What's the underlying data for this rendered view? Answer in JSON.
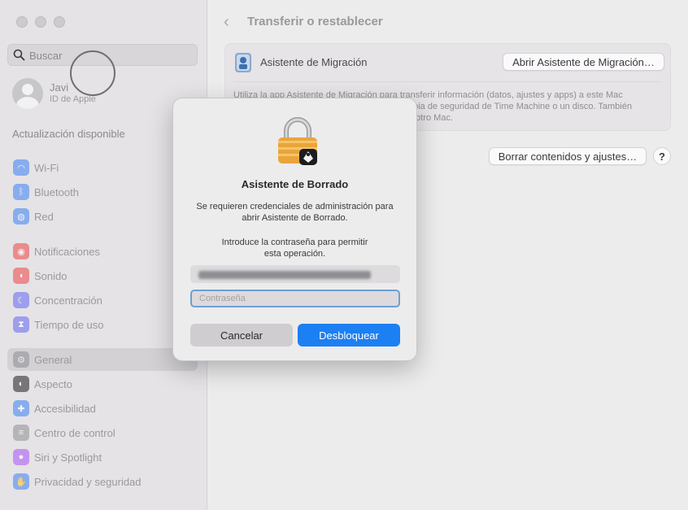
{
  "sidebar": {
    "search_placeholder": "Buscar",
    "profile": {
      "name": "Javi",
      "subtitle": "ID de Apple"
    },
    "update_label": "Actualización disponible",
    "items": [
      {
        "label": "Wi-Fi",
        "icon": "wifi-icon",
        "color": "#3b82f6"
      },
      {
        "label": "Bluetooth",
        "icon": "bluetooth-icon",
        "color": "#3b82f6"
      },
      {
        "label": "Red",
        "icon": "globe-icon",
        "color": "#3b82f6"
      },
      {
        "label": "Notificaciones",
        "icon": "bell-icon",
        "color": "#ef4444"
      },
      {
        "label": "Sonido",
        "icon": "speaker-icon",
        "color": "#ef4444"
      },
      {
        "label": "Concentración",
        "icon": "moon-icon",
        "color": "#6366f1"
      },
      {
        "label": "Tiempo de uso",
        "icon": "hourglass-icon",
        "color": "#6366f1"
      },
      {
        "label": "General",
        "icon": "gear-icon",
        "color": "#8e8e93"
      },
      {
        "label": "Aspecto",
        "icon": "appearance-icon",
        "color": "#1c1c1e"
      },
      {
        "label": "Accesibilidad",
        "icon": "accessibility-icon",
        "color": "#3b82f6"
      },
      {
        "label": "Centro de control",
        "icon": "control-center-icon",
        "color": "#8e8e93"
      },
      {
        "label": "Siri y Spotlight",
        "icon": "siri-icon",
        "color": "#a855f7"
      },
      {
        "label": "Privacidad y seguridad",
        "icon": "hand-icon",
        "color": "#3b82f6"
      }
    ]
  },
  "main": {
    "title": "Transferir o restablecer",
    "migration": {
      "name": "Asistente de Migración",
      "button": "Abrir Asistente de Migración…",
      "description_lines": [
        "Utiliza la app Asistente de Migración para transferir información (datos, ajustes y apps) a este Mac",
        "opia de seguridad de Time Machine o un disco. También",
        "a otro Mac."
      ]
    },
    "erase_button": "Borrar contenidos y ajustes…",
    "help": "?"
  },
  "dialog": {
    "title": "Asistente de Borrado",
    "message_1": "Se requieren credenciales de administración para",
    "message_2": "abrir Asistente de Borrado.",
    "prompt_1": "Introduce la contraseña para permitir",
    "prompt_2": "esta operación.",
    "password_placeholder": "Contraseña",
    "cancel": "Cancelar",
    "unlock": "Desbloquear"
  }
}
